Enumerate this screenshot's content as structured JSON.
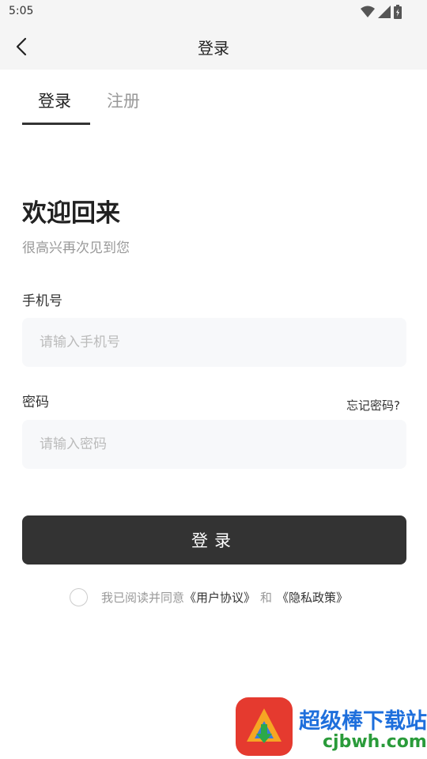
{
  "status_bar": {
    "time": "5:05",
    "icons": [
      "wifi-icon",
      "signal-icon",
      "battery-icon"
    ]
  },
  "nav": {
    "back_icon": "chevron-left-icon",
    "title": "登录"
  },
  "tabs": [
    {
      "label": "登录",
      "active": true
    },
    {
      "label": "注册",
      "active": false
    }
  ],
  "welcome": {
    "title": "欢迎回来",
    "subtitle": "很高兴再次见到您"
  },
  "form": {
    "phone_label": "手机号",
    "phone_placeholder": "请输入手机号",
    "phone_value": "",
    "password_label": "密码",
    "forgot_label": "忘记密码?",
    "password_placeholder": "请输入密码",
    "password_value": "",
    "submit_label": "登录"
  },
  "agreement": {
    "checked": false,
    "prefix": "我已阅读并同意",
    "user_agreement": "《用户协议》",
    "and": "和",
    "privacy_policy": "《隐私政策》"
  },
  "watermark": {
    "title": "超级棒下载站",
    "subtitle": "cjbwh.com"
  },
  "colors": {
    "accent": "#333333",
    "muted_text": "#999999",
    "input_bg": "#f7f8fa",
    "header_bg": "#f5f5f5"
  }
}
